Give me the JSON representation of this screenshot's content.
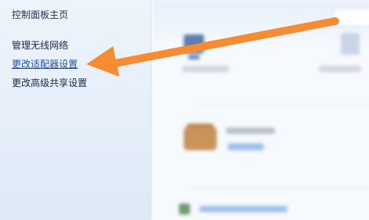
{
  "nav": {
    "title": "控制面板主页",
    "items": [
      {
        "label": "管理无线网络"
      },
      {
        "label": "更改适配器设置"
      },
      {
        "label": "更改高级共享设置"
      }
    ]
  },
  "colors": {
    "annotation_arrow": "#f58b33",
    "active_link": "#1f4fae"
  },
  "icons": {
    "computer": "computer-icon",
    "network": "network-icon",
    "bench": "network-location-icon",
    "bottom": "settings-icon",
    "arrow": "annotation-arrow"
  }
}
